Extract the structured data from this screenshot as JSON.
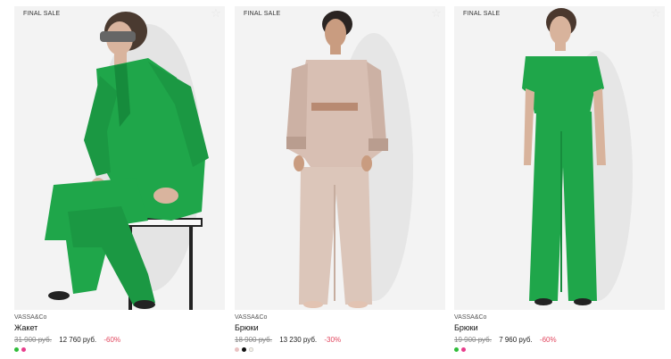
{
  "products": [
    {
      "badge": "FINAL SALE",
      "brand": "VASSA&Co",
      "name": "Жакет",
      "old_price": "31 900 руб.",
      "price": "12 760 руб.",
      "discount": "-60%",
      "swatches": [
        "#2ebd3a",
        "#e83e8c"
      ],
      "fav_icon": "heart-icon"
    },
    {
      "badge": "FINAL SALE",
      "brand": "VASSA&Co",
      "name": "Брюки",
      "old_price": "18 900 руб.",
      "price": "13 230 руб.",
      "discount": "-30%",
      "swatches": [
        "#e9c3c3",
        "#111111",
        "#f2efe6"
      ],
      "fav_icon": "heart-icon"
    },
    {
      "badge": "FINAL SALE",
      "brand": "VASSA&Co",
      "name": "Брюки",
      "old_price": "19 900 руб.",
      "price": "7 960 руб.",
      "discount": "-60%",
      "swatches": [
        "#2ebd3a",
        "#e83e8c"
      ],
      "fav_icon": "heart-icon"
    }
  ],
  "colors": {
    "discount": "#e2465e",
    "green_garment": "#1fa64a",
    "beige_garment": "#d8bfb3"
  }
}
